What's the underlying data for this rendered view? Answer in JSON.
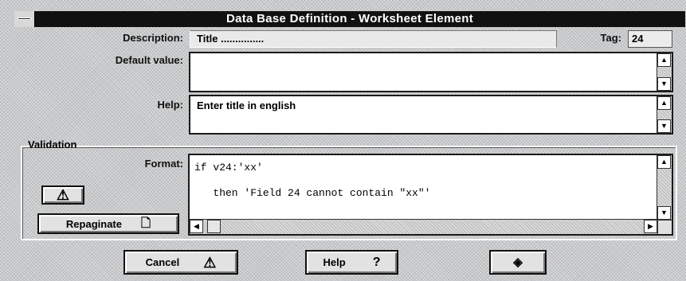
{
  "window": {
    "title": "Data Base Definition - Worksheet Element"
  },
  "form": {
    "description_label": "Description:",
    "description_value": "Title ...............",
    "tag_label": "Tag:",
    "tag_value": "24",
    "default_label": "Default value:",
    "default_value": "",
    "help_label": "Help:",
    "help_value": "Enter title in english"
  },
  "validation": {
    "group_title": "Validation",
    "format_label": "Format:",
    "format_lines": [
      "if v24:'xx'",
      "   then 'Field 24 cannot contain \"xx\"'"
    ],
    "repaginate_label": "Repaginate"
  },
  "buttons": {
    "cancel": "Cancel",
    "help": "Help",
    "help_symbol": "?"
  },
  "icons": [
    "system-menu-icon",
    "warning-triangle-icon",
    "page-icon",
    "scroll-up-icon",
    "scroll-down-icon",
    "scroll-left-icon",
    "scroll-right-icon",
    "diamond-icon"
  ]
}
